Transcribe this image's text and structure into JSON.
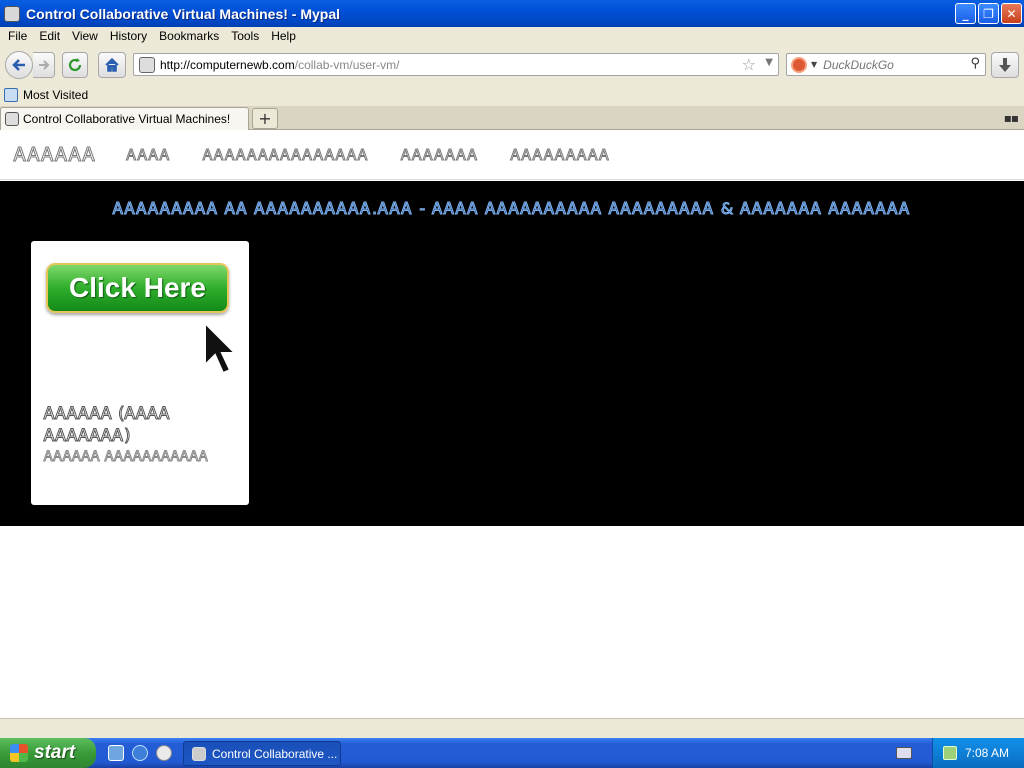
{
  "window": {
    "title": "Control Collaborative Virtual Machines! - Mypal",
    "controls": [
      "_",
      "❐",
      "✕"
    ]
  },
  "menu": [
    "File",
    "Edit",
    "View",
    "History",
    "Bookmarks",
    "Tools",
    "Help"
  ],
  "navigation": {
    "url_domain": "http://computernewb.com",
    "url_path": "/collab-vm/user-vm/",
    "search_placeholder": "DuckDuckGo"
  },
  "bookmarks": {
    "most_visited": "Most Visited"
  },
  "tabs": [
    {
      "label": "Control Collaborative Virtual Machines!"
    }
  ],
  "page": {
    "nav_items": [
      "ᎪᎪᎪᎪᎪᎪ",
      "ᎪᎪᎪᎪ",
      "ᎪᎪᎪᎪᎪᎪᎪᎪᎪᎪᎪᎪᎪᎪᎪ",
      "ᎪᎪᎪᎪᎪᎪᎪ",
      "ᎪᎪᎪᎪᎪᎪᎪᎪᎪ"
    ],
    "hero_title": "ᎪᎪᎪᎪᎪᎪᎪᎪᎪ ᎪᎪ ᎪᎪᎪᎪᎪᎪᎪᎪᎪᎪ.ᎪᎪᎪ - ᎪᎪᎪᎪ ᎪᎪᎪᎪᎪᎪᎪᎪᎪᎪ ᎪᎪᎪᎪᎪᎪᎪᎪᎪ & ᎪᎪᎪᎪᎪᎪᎪ ᎪᎪᎪᎪᎪᎪᎪ",
    "vm_card": {
      "button_label": "Click Here",
      "title": "ᎪᎪᎪᎪᎪᎪ (ᎪᎪᎪᎪ ᎪᎪᎪᎪᎪᎪᎪ)",
      "subtitle": "ᎪᎪᎪᎪᎪᎪ ᎪᎪᎪᎪᎪᎪᎪᎪᎪᎪᎪ"
    }
  },
  "taskbar": {
    "start_label": "start",
    "task_label": "Control Collaborative ...",
    "clock": "7:08 AM"
  }
}
